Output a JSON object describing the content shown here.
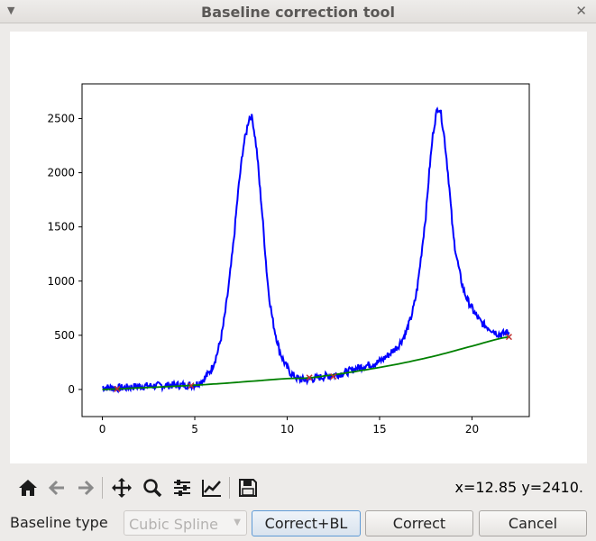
{
  "window": {
    "title": "Baseline correction tool"
  },
  "toolbar": {
    "icons": [
      "home-icon",
      "back-arrow-icon",
      "forward-arrow-icon",
      "pan-icon",
      "zoom-icon",
      "sliders-icon",
      "axes-icon",
      "save-icon"
    ],
    "coords": "x=12.85 y=2410."
  },
  "controls": {
    "baseline_type_label": "Baseline type",
    "baseline_type_value": "Cubic Spline",
    "correct_bl_label": "Correct+BL",
    "correct_label": "Correct",
    "cancel_label": "Cancel"
  },
  "chart_data": {
    "type": "line",
    "title": "",
    "xlabel": "",
    "ylabel": "",
    "xlim": [
      -1.1,
      23.1
    ],
    "ylim": [
      -250,
      2820
    ],
    "xticks": [
      0,
      5,
      10,
      15,
      20
    ],
    "yticks": [
      0,
      500,
      1000,
      1500,
      2000,
      2500
    ],
    "xtick_labels": [
      "0",
      "5",
      "10",
      "15",
      "20"
    ],
    "ytick_labels": [
      "0",
      "500",
      "1000",
      "1500",
      "2000",
      "2500"
    ],
    "grid": false,
    "series": [
      {
        "kind": "signal",
        "color": "#0000ff",
        "x": [
          0,
          1,
          2,
          3,
          4,
          5,
          5.5,
          6,
          6.5,
          7,
          7.5,
          7.8,
          8,
          8.2,
          8.5,
          9,
          9.5,
          10,
          10.5,
          11,
          12,
          13,
          14,
          15,
          16,
          16.5,
          17,
          17.5,
          17.8,
          18,
          18.2,
          18.4,
          18.7,
          19,
          19.5,
          20,
          20.5,
          21,
          21.5,
          22
        ],
        "y": [
          20,
          15,
          30,
          35,
          40,
          45,
          100,
          230,
          550,
          1200,
          2050,
          2380,
          2520,
          2400,
          1900,
          900,
          420,
          200,
          110,
          90,
          120,
          150,
          210,
          260,
          400,
          560,
          900,
          1600,
          2200,
          2480,
          2600,
          2450,
          2000,
          1400,
          950,
          750,
          620,
          560,
          510,
          530
        ]
      },
      {
        "kind": "baseline",
        "color": "#008000",
        "x": [
          0,
          2,
          4,
          6,
          8,
          10,
          11,
          12,
          14,
          16,
          18,
          20,
          22
        ],
        "y": [
          0,
          15,
          30,
          50,
          75,
          100,
          105,
          125,
          175,
          235,
          310,
          400,
          485
        ]
      }
    ],
    "anchor_points": {
      "color": "#c03030",
      "x": [
        0.8,
        4.8,
        11.2,
        12.5,
        22
      ],
      "y": [
        5,
        35,
        110,
        120,
        485
      ]
    }
  }
}
